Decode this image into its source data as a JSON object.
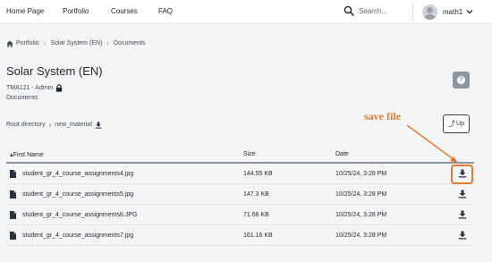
{
  "nav": {
    "links": [
      "Home Page",
      "Portfolio",
      "Courses",
      "FAQ"
    ],
    "search_placeholder": "Search...",
    "user_name": "math1"
  },
  "breadcrumb": [
    "Portfolio",
    "Solar System (EN)",
    "Documents"
  ],
  "course": {
    "title": "Solar System (EN)",
    "owner": "TMA121 - Admin",
    "section": "Documents",
    "help_symbol": "?"
  },
  "directory": {
    "root": "Root directory",
    "current": "new_material",
    "up_label": "Up"
  },
  "annotation": {
    "text": "save file",
    "color": "#e67a2c"
  },
  "table": {
    "headers": {
      "name": "First Name",
      "size": "Size",
      "date": "Date"
    },
    "sort_indicator": "▴",
    "rows": [
      {
        "name": "student_gr_4_course_assignments4.jpg",
        "size": "144.55 KB",
        "date": "10/25/24, 3:28 PM"
      },
      {
        "name": "student_gr_4_course_assignments5.jpg",
        "size": "147.3 KB",
        "date": "10/25/24, 3:28 PM"
      },
      {
        "name": "student_gr_4_course_assignments6.JPG",
        "size": "71.66 KB",
        "date": "10/25/24, 3:28 PM"
      },
      {
        "name": "student_gr_4_course_assignments7.jpg",
        "size": "161.16 KB",
        "date": "10/25/24, 3:28 PM"
      }
    ]
  },
  "icons": {
    "search": "search-icon",
    "user": "user-avatar-icon",
    "home": "home-icon",
    "lock": "lock-icon",
    "file": "file-icon",
    "download": "download-icon"
  }
}
